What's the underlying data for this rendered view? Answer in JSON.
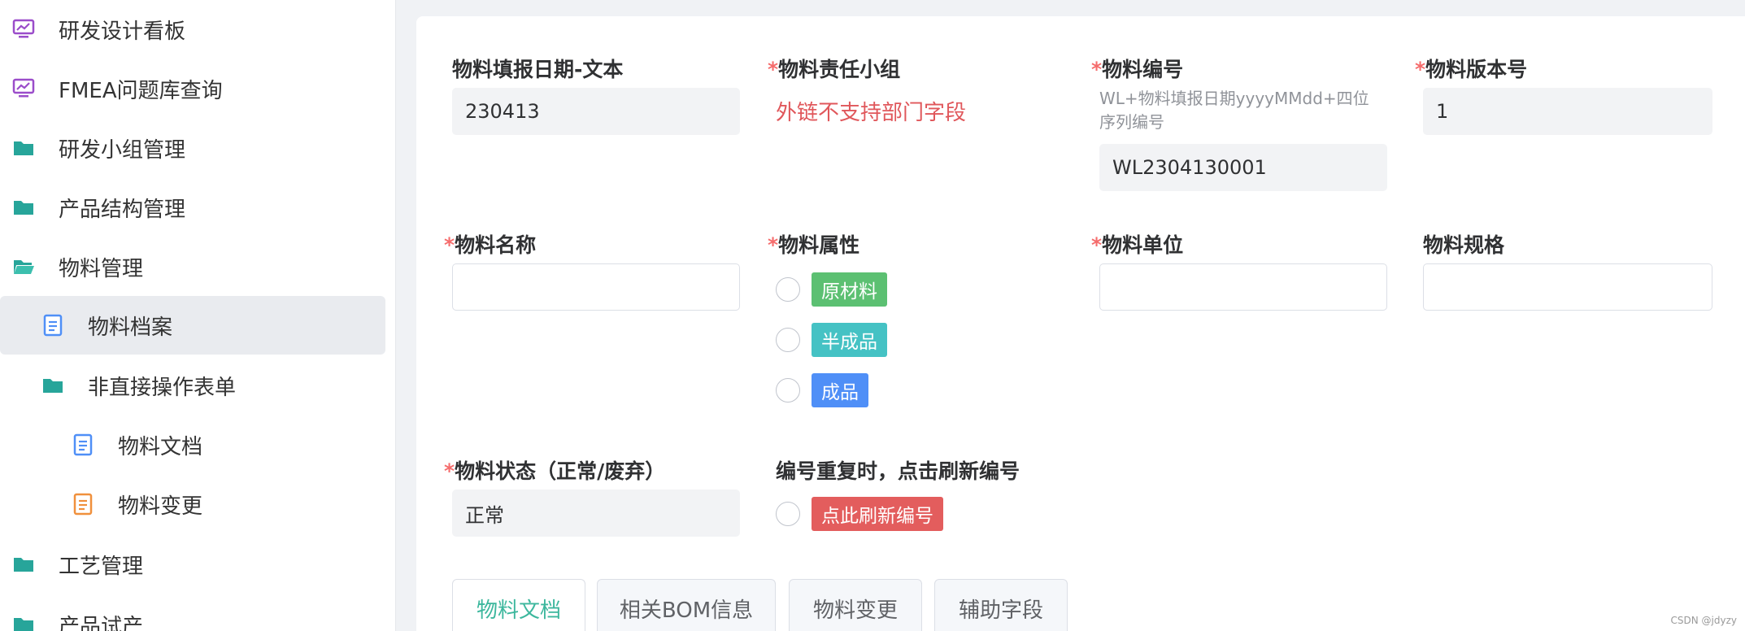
{
  "sidebar": {
    "items": [
      {
        "label": "研发设计看板",
        "icon": "monitor-chart-icon"
      },
      {
        "label": "FMEA问题库查询",
        "icon": "monitor-chart-icon"
      },
      {
        "label": "研发小组管理",
        "icon": "folder-icon"
      },
      {
        "label": "产品结构管理",
        "icon": "folder-icon"
      },
      {
        "label": "物料管理",
        "icon": "folder-open-icon"
      },
      {
        "label": "物料档案",
        "icon": "document-icon",
        "active": true
      },
      {
        "label": "非直接操作表单",
        "icon": "folder-icon"
      },
      {
        "label": "物料文档",
        "icon": "document-icon"
      },
      {
        "label": "物料变更",
        "icon": "document-icon"
      },
      {
        "label": "工艺管理",
        "icon": "folder-icon"
      },
      {
        "label": "产品试产",
        "icon": "folder-icon"
      }
    ]
  },
  "form": {
    "fill_date": {
      "label": "物料填报日期-文本",
      "value": "230413"
    },
    "team": {
      "star": "*",
      "label": "物料责任小组",
      "warning": "外链不支持部门字段"
    },
    "code": {
      "star": "*",
      "label": "物料编号",
      "hint_line1": "WL+物料填报日期yyyyMMdd+四位",
      "hint_line2": "序列编号",
      "value": "WL2304130001"
    },
    "version": {
      "star": "*",
      "label": "物料版本号",
      "value": "1"
    },
    "name": {
      "star": "*",
      "label": "物料名称",
      "value": ""
    },
    "attribute": {
      "star": "*",
      "label": "物料属性",
      "options": [
        {
          "label": "原材料",
          "color": "#5cc072"
        },
        {
          "label": "半成品",
          "color": "#45c2c4"
        },
        {
          "label": "成品",
          "color": "#4f8ff7"
        }
      ]
    },
    "unit": {
      "star": "*",
      "label": "物料单位",
      "value": ""
    },
    "spec": {
      "label": "物料规格",
      "value": ""
    },
    "status": {
      "star": "*",
      "label": "物料状态（正常/废弃）",
      "value": "正常"
    },
    "refresh": {
      "label": "编号重复时，点击刷新编号",
      "button_label": "点此刷新编号",
      "color": "#e35d5d"
    }
  },
  "tabs": [
    {
      "label": "物料文档",
      "active": true
    },
    {
      "label": "相关BOM信息"
    },
    {
      "label": "物料变更"
    },
    {
      "label": "辅助字段"
    }
  ],
  "watermark": "CSDN @jdyzy",
  "colors": {
    "accent": "#3cb79d",
    "required": "#f56c6c",
    "icon_purple": "#9b4dca",
    "icon_teal": "#27a59a",
    "icon_blue": "#4f8ff7",
    "icon_orange": "#f0903c"
  }
}
